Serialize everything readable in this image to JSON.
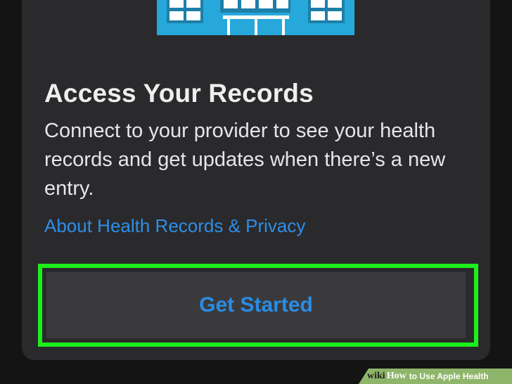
{
  "card": {
    "title": "Access Your Records",
    "description": "Connect to your provider to see your health records and get updates when there’s a new entry.",
    "link_label": "About Health Records & Privacy",
    "button_label": "Get Started",
    "hero_icon": "hospital-building-icon"
  },
  "watermark": {
    "prefix": "wiki",
    "how": "How",
    "title": "to Use Apple Health"
  },
  "colors": {
    "accent_blue": "#2d8ee8",
    "highlight_green": "#1bf01b",
    "hero_blue": "#26a8db"
  }
}
